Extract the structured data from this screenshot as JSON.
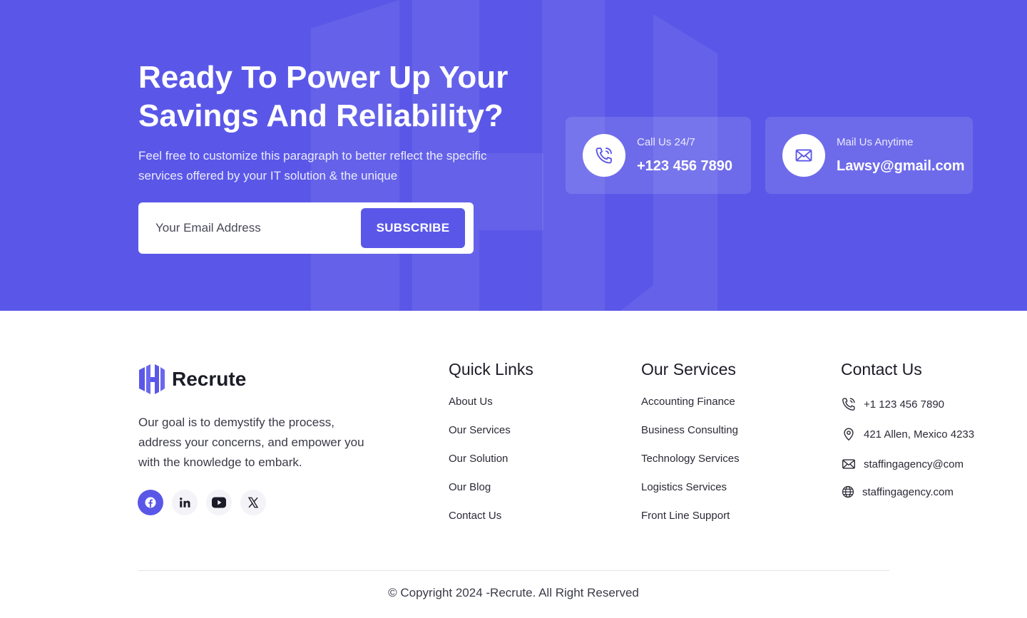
{
  "cta": {
    "title": "Ready To Power Up Your Savings And Reliability?",
    "text": "Feel free to customize this paragraph to better reflect the specific services offered by your IT solution & the unique",
    "email_placeholder": "Your Email Address",
    "subscribe_label": "SUBSCRIBE",
    "call": {
      "label": "Call Us 24/7",
      "value": "+123 456 7890",
      "icon": "phone-icon"
    },
    "mail": {
      "label": "Mail Us Anytime",
      "value": "Lawsy@gmail.com",
      "icon": "mail-icon"
    }
  },
  "footer": {
    "brand": "Recrute",
    "about": "Our goal is to demystify the process, address your concerns, and empower you with the knowledge to embark.",
    "socials": [
      "facebook-icon",
      "linkedin-icon",
      "youtube-icon",
      "x-icon"
    ],
    "quick_links": {
      "title": "Quick Links",
      "items": [
        "About Us",
        "Our Services",
        "Our Solution",
        "Our Blog",
        "Contact Us"
      ]
    },
    "services": {
      "title": "Our Services",
      "items": [
        "Accounting Finance",
        "Business Consulting",
        "Technology Services",
        "Logistics Services",
        "Front Line Support"
      ]
    },
    "contact": {
      "title": "Contact Us",
      "phone": "+1 123 456 7890",
      "address": "421 Allen, Mexico 4233",
      "email": "staffingagency@com",
      "website": "staffingagency.com"
    },
    "copyright": "© Copyright 2024 -Recrute. All Right Reserved"
  },
  "colors": {
    "accent": "#5a57e8",
    "text": "#1c1c28",
    "muted": "#3a3a48"
  }
}
